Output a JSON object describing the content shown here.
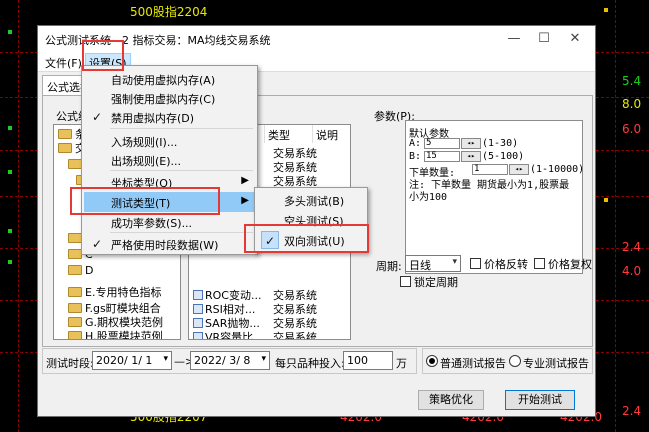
{
  "background": {
    "top_label": "500股指2204",
    "bottom_label": "500股指2207",
    "right_values": [
      "5.4",
      "8.0",
      "6.0",
      "2.4",
      "4.0",
      "2.4"
    ],
    "bottom_values": [
      "4202.0",
      "4202.0",
      "4202.0"
    ]
  },
  "window": {
    "title": "公式测试系统 - 2 指标交易：MA均线交易系统",
    "minimize_glyph": "—",
    "maximize_glyph": "☐",
    "close_glyph": "✕"
  },
  "menubar": {
    "file": "文件(F)",
    "settings": "设置(S)"
  },
  "tab": {
    "label": "公式选择"
  },
  "formula_tree_label": "公式组",
  "tree_items": [
    {
      "label": "条件"
    },
    {
      "label": "交易"
    },
    {
      "label": "A"
    },
    {
      "label": ""
    },
    {
      "label": "B"
    },
    {
      "label": "C"
    },
    {
      "label": "D"
    },
    {
      "label": "E.专用特色指标"
    },
    {
      "label": "F.gs町模块组合"
    },
    {
      "label": "G.期权模块范例"
    },
    {
      "label": "H.股票模块范例"
    }
  ],
  "list_headers": {
    "type": "类型",
    "desc": "说明"
  },
  "list_rows": [
    {
      "name": "",
      "type": "交易系统"
    },
    {
      "name": "",
      "type": "交易系统"
    },
    {
      "name": "",
      "type": "交易系统"
    },
    {
      "name": "ROC变动...",
      "type": "交易系统"
    },
    {
      "name": "RSI相对...",
      "type": "交易系统"
    },
    {
      "name": "SAR抛物...",
      "type": "交易系统"
    },
    {
      "name": "VR容量比...",
      "type": "交易系统"
    }
  ],
  "params": {
    "label": "参数(P):",
    "default_title": "默认参数",
    "a_label": "A:",
    "a_value": "5",
    "a_range": "(1-30)",
    "b_label": "B:",
    "b_value": "15",
    "b_range": "(5-100)",
    "lot_label": "下单数量:",
    "lot_value": "1",
    "lot_range": "(1-10000)",
    "note_line1": "注: 下单数量 期货最小为1,股票最",
    "note_line2": "小为100",
    "spin_glyph": "◂▸"
  },
  "period": {
    "label": "周期:",
    "value": "日线",
    "lock_label": "锁定周期"
  },
  "checks": {
    "price_flip": "价格反转",
    "price_restore": "价格复权"
  },
  "bottom": {
    "test_period_label": "测试时段:",
    "start_date": "2020/ 1/ 1",
    "end_date": "2022/ 3/ 8",
    "per_stock_label": "每只品种投入:",
    "amount": "100",
    "unit": "万",
    "report_normal": "普通测试报告",
    "report_pro": "专业测试报告",
    "strategy_button": "策略优化",
    "start_button": "开始测试"
  },
  "settings_menu": {
    "items": [
      {
        "label": "自动使用虚拟内存(A)",
        "checked": false
      },
      {
        "label": "强制使用虚拟内存(C)",
        "checked": false
      },
      {
        "label": "禁用虚拟内存(D)",
        "checked": true
      },
      {
        "label": "入场规则(I)...",
        "checked": false
      },
      {
        "label": "出场规则(E)...",
        "checked": false
      },
      {
        "label": "坐标类型(Q)",
        "checked": false
      },
      {
        "label": "测试类型(T)",
        "checked": false
      },
      {
        "label": "成功率参数(S)...",
        "checked": false
      },
      {
        "label": "严格使用时段数据(W)",
        "checked": true
      }
    ]
  },
  "test_type_submenu": {
    "items": [
      {
        "label": "多头测试(B)",
        "checked": false
      },
      {
        "label": "空头测试(S)",
        "checked": false
      },
      {
        "label": "双向测试(U)",
        "checked": true
      }
    ]
  },
  "glyphs": {
    "check": "✓",
    "arrow_right": "▶",
    "arrow_down": "▾",
    "arrow_right_date": "—>"
  },
  "colors": {
    "highlight": "#e53935",
    "menu_hover": "#91c9f7",
    "accent": "#0078d7"
  }
}
